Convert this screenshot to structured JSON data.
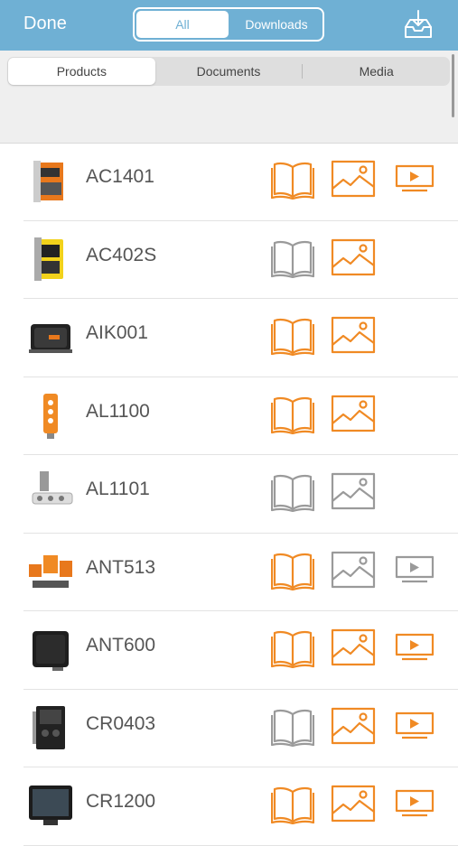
{
  "header": {
    "done_label": "Done",
    "segments": [
      "All",
      "Downloads"
    ],
    "selected_segment": "All",
    "download_icon": "tray-download-icon"
  },
  "tabs": {
    "items": [
      "Products",
      "Documents",
      "Media"
    ],
    "selected": "Products"
  },
  "colors": {
    "header_bg": "#6fb0d4",
    "available": "#f08a24",
    "unavailable": "#9a9a9a"
  },
  "products": [
    {
      "name": "AC1401",
      "thumb": "controller-orange",
      "docs": "available",
      "images": "available",
      "video": "available"
    },
    {
      "name": "AC402S",
      "thumb": "module-yellow",
      "docs": "unavailable",
      "images": "available",
      "video": "none"
    },
    {
      "name": "AIK001",
      "thumb": "box-black",
      "docs": "available",
      "images": "available",
      "video": "none"
    },
    {
      "name": "AL1100",
      "thumb": "sensor-orange",
      "docs": "available",
      "images": "available",
      "video": "none"
    },
    {
      "name": "AL1101",
      "thumb": "connector-grey",
      "docs": "unavailable",
      "images": "unavailable",
      "video": "none"
    },
    {
      "name": "ANT513",
      "thumb": "kit-orange",
      "docs": "available",
      "images": "unavailable",
      "video": "unavailable"
    },
    {
      "name": "ANT600",
      "thumb": "antenna-black",
      "docs": "available",
      "images": "available",
      "video": "available"
    },
    {
      "name": "CR0403",
      "thumb": "controller-black",
      "docs": "unavailable",
      "images": "available",
      "video": "available"
    },
    {
      "name": "CR1200",
      "thumb": "display-black",
      "docs": "available",
      "images": "available",
      "video": "available"
    }
  ]
}
